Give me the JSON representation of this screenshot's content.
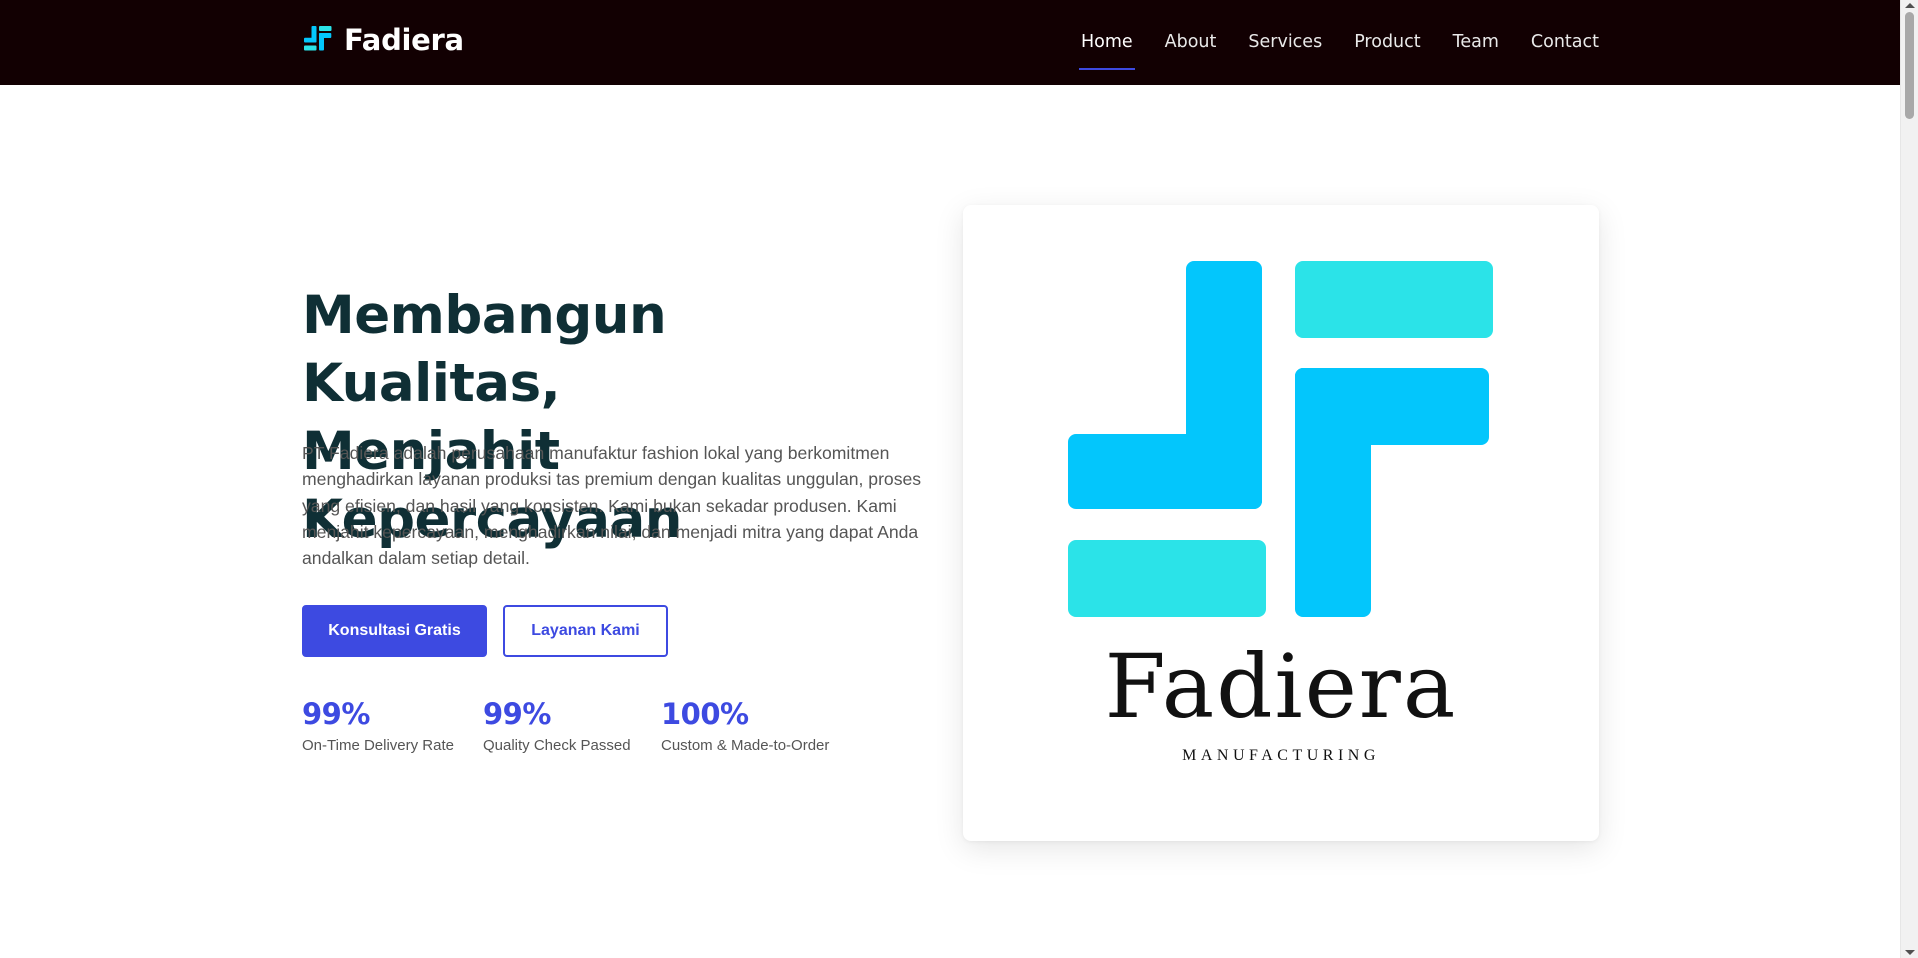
{
  "brand": {
    "name": "Fadiera",
    "logo_icon": "fadiera-f-mark-icon",
    "colors": {
      "cyan": "#03c6fc",
      "turquoise": "#2be3e8"
    }
  },
  "nav": {
    "items": [
      {
        "label": "Home",
        "active": true
      },
      {
        "label": "About",
        "active": false
      },
      {
        "label": "Services",
        "active": false
      },
      {
        "label": "Product",
        "active": false
      },
      {
        "label": "Team",
        "active": false
      },
      {
        "label": "Contact",
        "active": false
      }
    ]
  },
  "hero": {
    "title_line1": "Membangun Kualitas,",
    "title_line2": "Menjahit Kepercayaan",
    "description": "PT Fadiera adalah perusahaan manufaktur fashion lokal yang berkomitmen menghadirkan layanan produksi tas premium dengan kualitas unggulan, proses yang efisien, dan hasil yang konsisten. Kami bukan sekadar produsen. Kami menjahit kepercayaan, menghadirkan nilai, dan menjadi mitra yang dapat Anda andalkan dalam setiap detail.",
    "primary_button": "Konsultasi Gratis",
    "secondary_button": "Layanan Kami",
    "stats": [
      {
        "value": "99%",
        "label": "On-Time Delivery Rate"
      },
      {
        "value": "99%",
        "label": "Quality Check Passed"
      },
      {
        "value": "100%",
        "label": "Custom & Made-to-Order"
      }
    ]
  },
  "card": {
    "wordmark": "Fadiera",
    "tagline": "MANUFACTURING"
  },
  "theme": {
    "header_bg": "#120002",
    "accent": "#3d4ae1",
    "heading": "#0f2f35"
  }
}
